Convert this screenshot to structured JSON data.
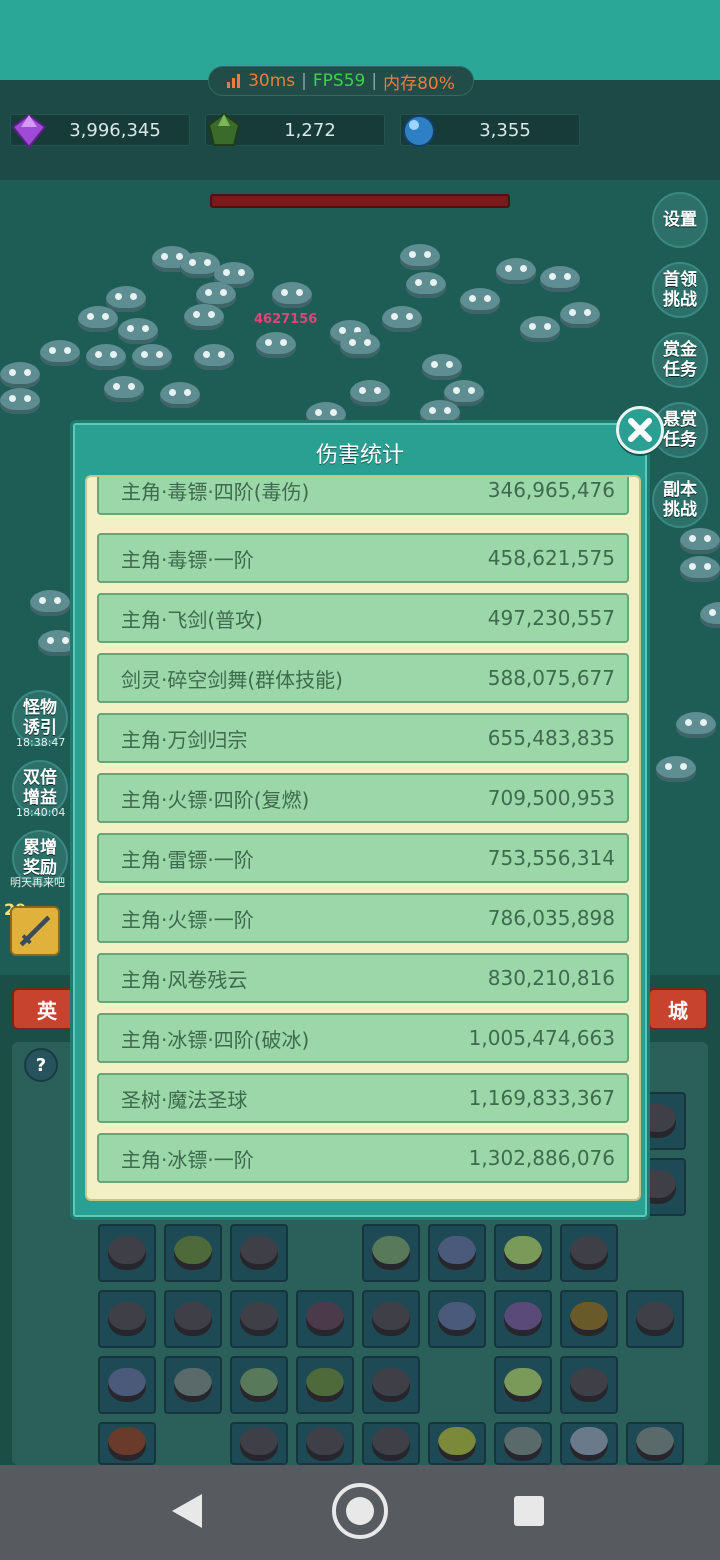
{
  "perf": {
    "ping": "30ms",
    "fps": "FPS59",
    "mem": "内存80%",
    "sep": "|"
  },
  "resources": [
    {
      "icon": "purple-gem-icon",
      "value": "3,996,345"
    },
    {
      "icon": "green-crystal-icon",
      "value": "1,272"
    },
    {
      "icon": "blue-orb-icon",
      "value": "3,355"
    }
  ],
  "arena": {
    "floating_damage": "4627156"
  },
  "right_buttons": [
    "设置",
    "首领\n挑战",
    "赏金\n任务",
    "悬赏\n任务",
    "副本\n挑战"
  ],
  "left_buttons": [
    {
      "label": "怪物\n诱引",
      "timer": "18:38:47"
    },
    {
      "label": "双倍\n增益",
      "timer": "18:40:04"
    },
    {
      "label": "累增\n奖励",
      "timer": "明天再来吧"
    }
  ],
  "bottom": {
    "level_badge": "29",
    "left_tab": "英",
    "right_tab": "城",
    "help": "?"
  },
  "modal": {
    "title": "伤害统计",
    "rows": [
      {
        "name": "主角·毒镖·四阶(毒伤)",
        "value": "346,965,476"
      },
      {
        "name": "主角·毒镖·一阶",
        "value": "458,621,575"
      },
      {
        "name": "主角·飞剑(普攻)",
        "value": "497,230,557"
      },
      {
        "name": "剑灵·碎空剑舞(群体技能)",
        "value": "588,075,677"
      },
      {
        "name": "主角·万剑归宗",
        "value": "655,483,835"
      },
      {
        "name": "主角·火镖·四阶(复燃)",
        "value": "709,500,953"
      },
      {
        "name": "主角·雷镖·一阶",
        "value": "753,556,314"
      },
      {
        "name": "主角·火镖·一阶",
        "value": "786,035,898"
      },
      {
        "name": "主角·风卷残云",
        "value": "830,210,816"
      },
      {
        "name": "主角·冰镖·四阶(破冰)",
        "value": "1,005,474,663"
      },
      {
        "name": "圣树·魔法圣球",
        "value": "1,169,833,367"
      },
      {
        "name": "主角·冰镖·一阶",
        "value": "1,302,886,076"
      }
    ]
  },
  "colors": {
    "accent": "#2aa092",
    "row_bg": "#9bd7a9",
    "row_text": "#3d6b4c",
    "ping": "#f07b3f",
    "fps": "#3ed14b"
  }
}
